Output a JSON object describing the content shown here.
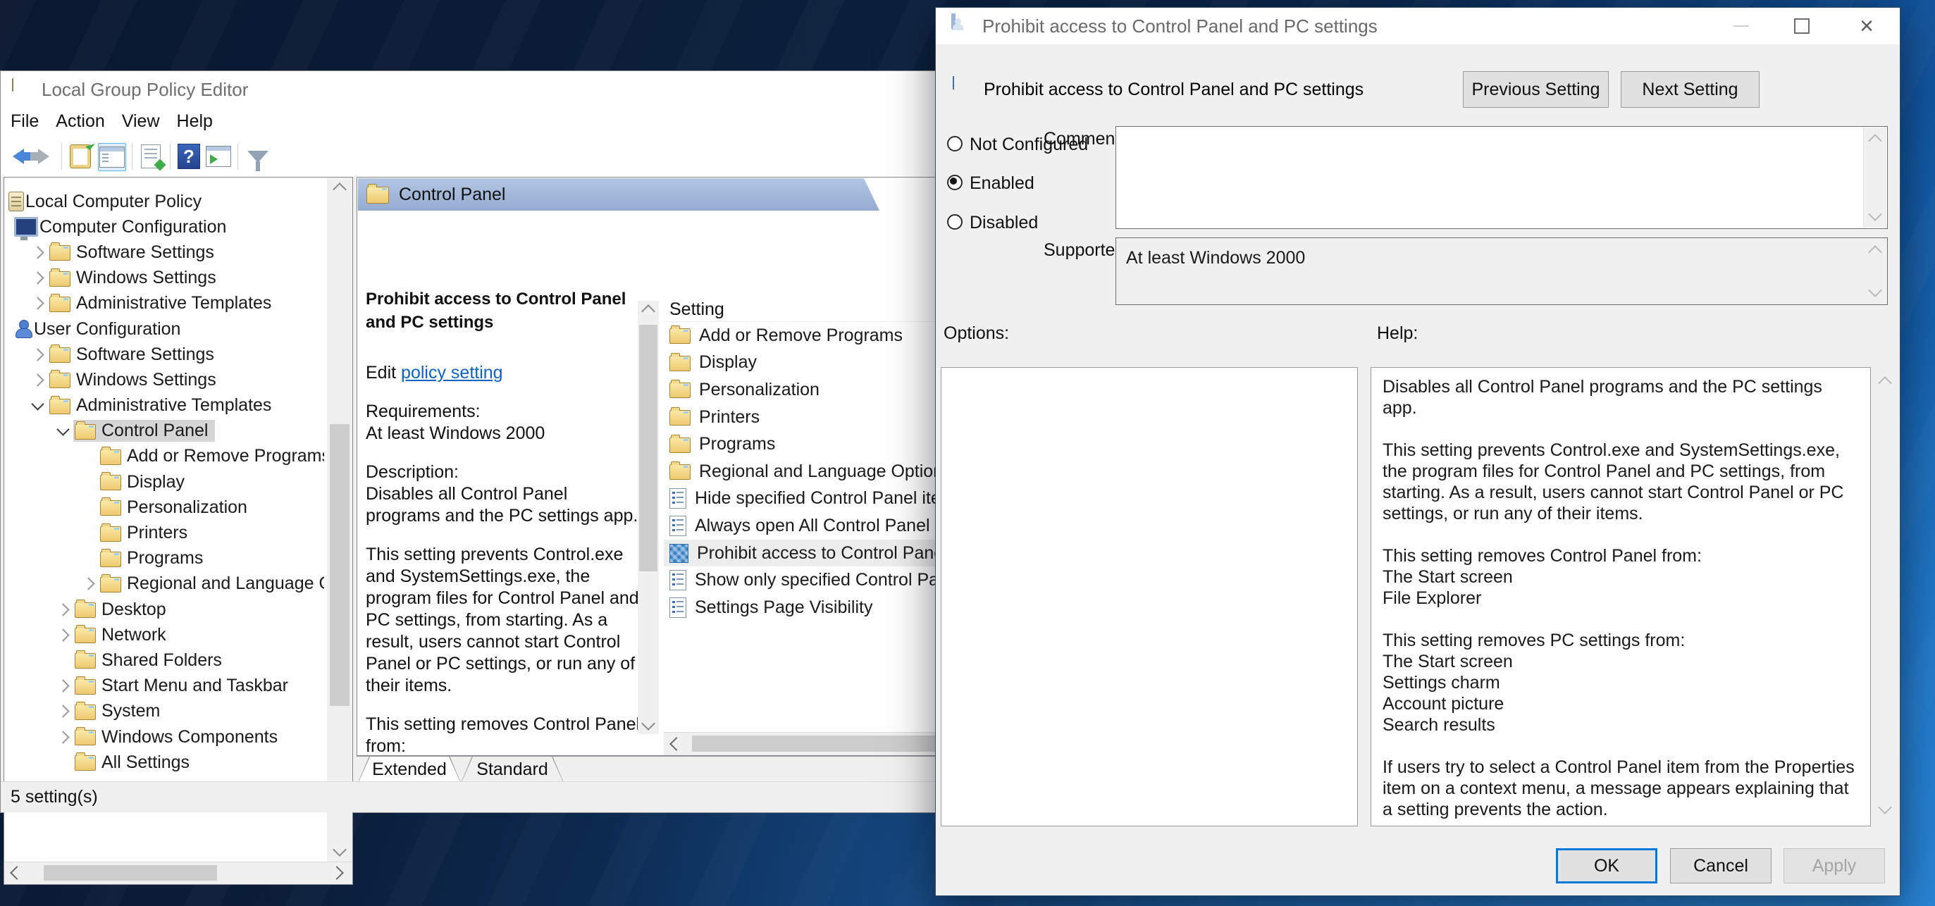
{
  "gpedit": {
    "window_title": "Local Group Policy Editor",
    "menu": {
      "items": [
        "File",
        "Action",
        "View",
        "Help"
      ]
    },
    "toolbar": {
      "icons": [
        "back",
        "forward",
        "export-list",
        "show-console-tree",
        "action-doc",
        "help",
        "show-action-pane",
        "filter"
      ]
    },
    "tree": {
      "items": [
        {
          "label": "Local Computer Policy"
        },
        {
          "label": "Computer Configuration"
        },
        {
          "label": "Software Settings"
        },
        {
          "label": "Windows Settings"
        },
        {
          "label": "Administrative Templates"
        },
        {
          "label": "User Configuration"
        },
        {
          "label": "Software Settings"
        },
        {
          "label": "Windows Settings"
        },
        {
          "label": "Administrative Templates"
        },
        {
          "label": "Control Panel"
        },
        {
          "label": "Add or Remove Programs"
        },
        {
          "label": "Display"
        },
        {
          "label": "Personalization"
        },
        {
          "label": "Printers"
        },
        {
          "label": "Programs"
        },
        {
          "label": "Regional and Language Options"
        },
        {
          "label": "Desktop"
        },
        {
          "label": "Network"
        },
        {
          "label": "Shared Folders"
        },
        {
          "label": "Start Menu and Taskbar"
        },
        {
          "label": "System"
        },
        {
          "label": "Windows Components"
        },
        {
          "label": "All Settings"
        }
      ]
    },
    "extended_pane": {
      "header": "Control Panel",
      "policy_title": "Prohibit access to Control Panel and PC settings",
      "edit_prefix": "Edit",
      "edit_link_label": "policy setting",
      "requirements": "Requirements:\nAt least Windows 2000",
      "description_intro": "Description:\nDisables all Control Panel programs and the PC settings app.",
      "description_para2": "This setting prevents Control.exe and SystemSettings.exe, the program files for Control Panel and PC settings, from starting. As a result, users cannot start Control Panel or PC settings, or run any of their items.",
      "description_para3": "This setting removes Control Panel from:\nThe Start screen\nFile Explorer"
    },
    "list": {
      "column_header": "Setting",
      "items": [
        {
          "label": "Add or Remove Programs",
          "icon": "folder"
        },
        {
          "label": "Display",
          "icon": "folder"
        },
        {
          "label": "Personalization",
          "icon": "folder"
        },
        {
          "label": "Printers",
          "icon": "folder"
        },
        {
          "label": "Programs",
          "icon": "folder"
        },
        {
          "label": "Regional and Language Options",
          "icon": "folder"
        },
        {
          "label": "Hide specified Control Panel items",
          "icon": "policy"
        },
        {
          "label": "Always open All Control Panel Items view",
          "icon": "policy"
        },
        {
          "label": "Prohibit access to Control Panel and PC settings",
          "icon": "policy-enabled",
          "selected": true
        },
        {
          "label": "Show only specified Control Panel items",
          "icon": "policy"
        },
        {
          "label": "Settings Page Visibility",
          "icon": "policy"
        }
      ]
    },
    "tabs": {
      "extended": "Extended",
      "standard": "Standard"
    },
    "status_bar": "5 setting(s)"
  },
  "dialog": {
    "window_title": "Prohibit access to Control Panel and PC settings",
    "policy_name": "Prohibit access to Control Panel and PC settings",
    "previous_button": "Previous Setting",
    "next_button": "Next Setting",
    "radio_not_configured": "Not Configured",
    "radio_enabled": "Enabled",
    "radio_disabled": "Disabled",
    "selected_state": "Enabled",
    "comment_label": "Comment:",
    "comment_value": "",
    "supported_label": "Supported on:",
    "supported_value": "At least Windows 2000",
    "options_label": "Options:",
    "help_label": "Help:",
    "help_text": {
      "p1": "Disables all Control Panel programs and the PC settings app.",
      "p2": "This setting prevents Control.exe and SystemSettings.exe, the program files for Control Panel and PC settings, from starting. As a result, users cannot start Control Panel or PC settings, or run any of their items.",
      "p3": "This setting removes Control Panel from:\nThe Start screen\nFile Explorer",
      "p4": "This setting removes PC settings from:\nThe Start screen\nSettings charm\nAccount picture\nSearch results",
      "p5": "If users try to select a Control Panel item from the Properties item on a context menu, a message appears explaining that a setting prevents the action."
    },
    "ok_button": "OK",
    "cancel_button": "Cancel",
    "apply_button": "Apply"
  },
  "colors": {
    "accent": "#0078d7",
    "band_top": "#b2c5e3",
    "band_bottom": "#95acd1",
    "inactive_selection": "#d6d6d6",
    "wallpaper_dark": "#0a1830",
    "wallpaper_bright": "#1e7ccd"
  }
}
